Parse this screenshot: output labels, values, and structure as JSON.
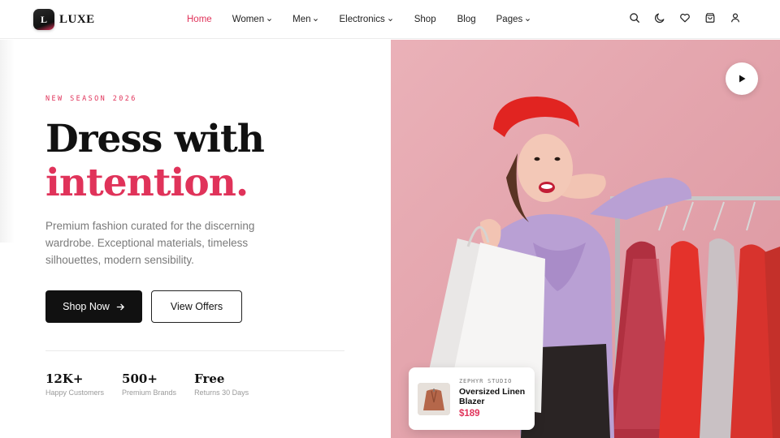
{
  "brand": {
    "mark": "L",
    "name": "LUXE"
  },
  "nav": [
    {
      "label": "Home",
      "active": true,
      "dropdown": false
    },
    {
      "label": "Women",
      "active": false,
      "dropdown": true
    },
    {
      "label": "Men",
      "active": false,
      "dropdown": true
    },
    {
      "label": "Electronics",
      "active": false,
      "dropdown": true
    },
    {
      "label": "Shop",
      "active": false,
      "dropdown": false
    },
    {
      "label": "Blog",
      "active": false,
      "dropdown": false
    },
    {
      "label": "Pages",
      "active": false,
      "dropdown": true
    }
  ],
  "header_icons": [
    "search-icon",
    "moon-icon",
    "heart-icon",
    "cart-icon",
    "user-icon"
  ],
  "hero": {
    "eyebrow": "NEW SEASON 2026",
    "headline_line1": "Dress with",
    "headline_line2": "intention.",
    "description": "Premium fashion curated for the discerning wardrobe. Exceptional materials, timeless silhouettes, modern sensibility.",
    "primary_cta": "Shop Now",
    "secondary_cta": "View Offers"
  },
  "stats": [
    {
      "value": "12K+",
      "label": "Happy Customers"
    },
    {
      "value": "500+",
      "label": "Premium Brands"
    },
    {
      "value": "Free",
      "label": "Returns 30 Days"
    }
  ],
  "product_card": {
    "brand": "ZEPHYR STUDIO",
    "name": "Oversized Linen Blazer",
    "price": "$189"
  },
  "colors": {
    "accent": "#e0335a",
    "dark": "#111111",
    "hero_bg": "#e8a9b1"
  }
}
